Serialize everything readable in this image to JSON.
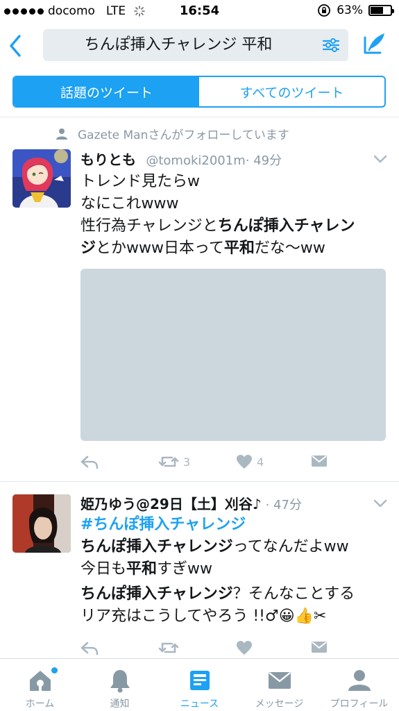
{
  "status_bar": {
    "carrier": "docomo",
    "network": "LTE",
    "time": "16:54",
    "battery_percent": "63%",
    "battery_level": 0.63
  },
  "search": {
    "query": "ちんぽ挿入チャレンジ 平和"
  },
  "segments": [
    {
      "label": "話題のツイート",
      "active": true
    },
    {
      "label": "すべてのツイート",
      "active": false
    }
  ],
  "tweet1": {
    "social_context": "Gazete Manさんがフォローしています",
    "name": "もりとも",
    "handle": "@tomoki2001m",
    "time": "· 49分",
    "line1": "トレンド見たらw",
    "line2": "なにこれwww",
    "line3a": "性行為チャレンジと",
    "line3b": "ちんぽ挿入チャレン",
    "line4a": "ジ",
    "line4b": "とかwww日本って",
    "line4c": "平和",
    "line4d": "だな〜ww",
    "retweets": "3",
    "likes": "4"
  },
  "tweet2": {
    "name": "姫乃ゆう@29日【土】刈谷♪",
    "time": "· 47分",
    "hashtag": "#ちんぽ挿入チャレンジ",
    "line2a": "ちんぽ挿入チャレンジ",
    "line2b": "ってなんだよww",
    "line3a": "今日も",
    "line3b": "平和",
    "line3c": "すぎww",
    "line4a": "ちんぽ挿入チャレンジ",
    "line4b": "？そんなことする",
    "line5": "リア充はこうしてやろう !!♂😀👍✂"
  },
  "tabs": [
    {
      "label": "ホーム",
      "icon": "home-icon"
    },
    {
      "label": "通知",
      "icon": "bell-icon"
    },
    {
      "label": "ニュース",
      "icon": "news-icon",
      "active": true
    },
    {
      "label": "メッセージ",
      "icon": "envelope-icon"
    },
    {
      "label": "プロフィール",
      "icon": "person-icon"
    }
  ],
  "colors": {
    "accent": "#1da1f2",
    "muted": "#8899a6",
    "media_placeholder": "#ccd6dd"
  }
}
